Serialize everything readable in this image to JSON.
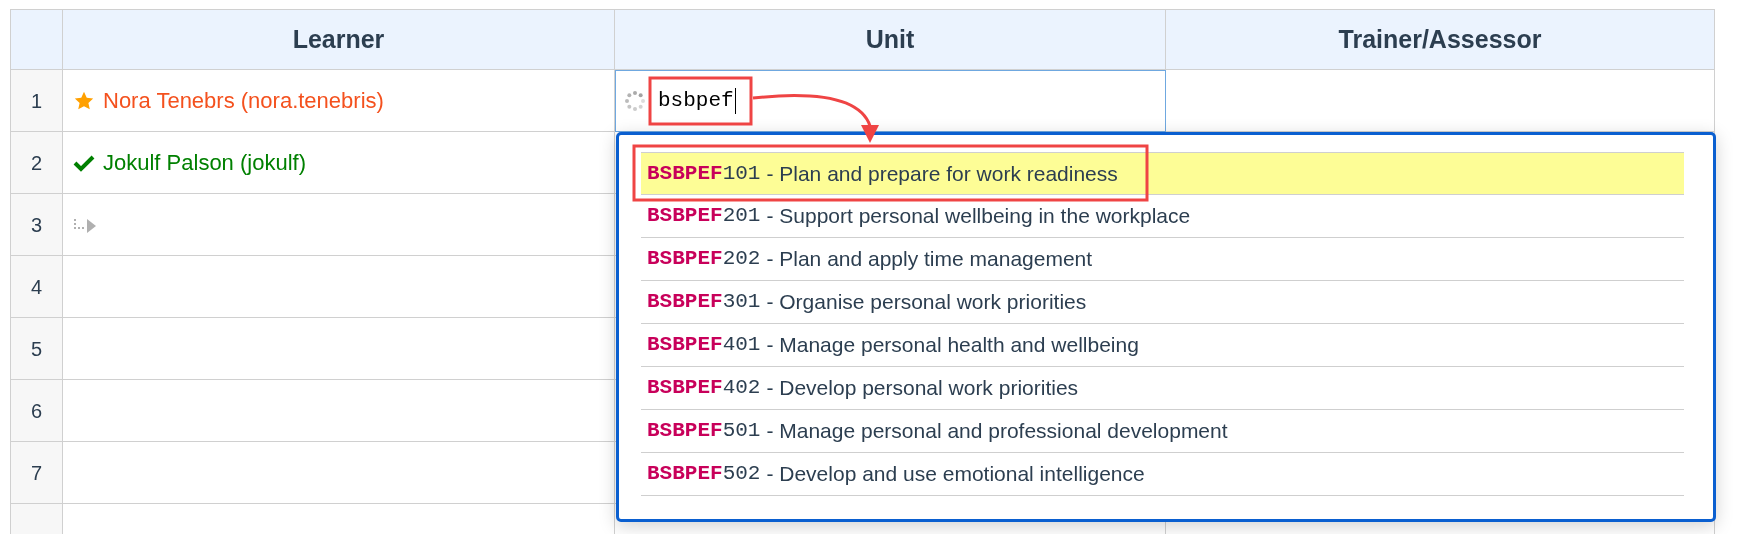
{
  "table": {
    "columns": [
      "Learner",
      "Unit",
      "Trainer/Assessor"
    ],
    "rows": [
      {
        "number": "1",
        "learner": {
          "kind": "starred",
          "name": "Nora Tenebrs (nora.tenebris)",
          "color": "#f4511e"
        },
        "unit": {
          "editing": true,
          "loading": true,
          "value": "bsbpef"
        }
      },
      {
        "number": "2",
        "learner": {
          "kind": "done",
          "name": "Jokulf Palson (jokulf)",
          "color": "#008000"
        }
      },
      {
        "number": "3",
        "learner": {
          "kind": "new"
        }
      },
      {
        "number": "4"
      },
      {
        "number": "5"
      },
      {
        "number": "6"
      },
      {
        "number": "7"
      }
    ]
  },
  "dropdown": {
    "options": [
      {
        "match": "BSBPEF",
        "code": "101",
        "text": "- Plan and prepare for work readiness",
        "selected": true
      },
      {
        "match": "BSBPEF",
        "code": "201",
        "text": "- Support personal wellbeing in the workplace",
        "selected": false
      },
      {
        "match": "BSBPEF",
        "code": "202",
        "text": "- Plan and apply time management",
        "selected": false
      },
      {
        "match": "BSBPEF",
        "code": "301",
        "text": "- Organise personal work priorities",
        "selected": false
      },
      {
        "match": "BSBPEF",
        "code": "401",
        "text": "- Manage personal health and wellbeing",
        "selected": false
      },
      {
        "match": "BSBPEF",
        "code": "402",
        "text": "- Develop personal work priorities",
        "selected": false
      },
      {
        "match": "BSBPEF",
        "code": "501",
        "text": "- Manage personal and professional development",
        "selected": false
      },
      {
        "match": "BSBPEF",
        "code": "502",
        "text": "- Develop and use emotional intelligence",
        "selected": false
      }
    ]
  }
}
